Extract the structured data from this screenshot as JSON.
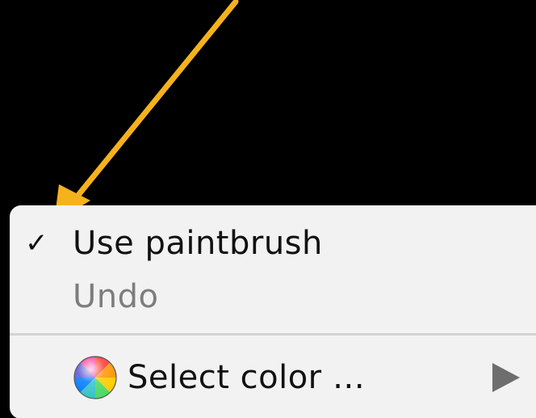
{
  "menu": {
    "items": [
      {
        "label": "Use paintbrush",
        "checked": true,
        "check_glyph": "✓",
        "enabled": true
      },
      {
        "label": "Undo",
        "checked": false,
        "enabled": false
      },
      {
        "label": "Select color …",
        "icon": "color-wheel-icon",
        "has_submenu": true,
        "enabled": true
      }
    ]
  },
  "colors": {
    "background": "#000000",
    "menu_background": "#f2f2f2",
    "annotation_arrow": "#f5b21c",
    "text": "#111111",
    "disabled_text": "#7d7d7d",
    "separator": "#d3d3d3",
    "submenu_arrow": "#6e6e6e"
  }
}
